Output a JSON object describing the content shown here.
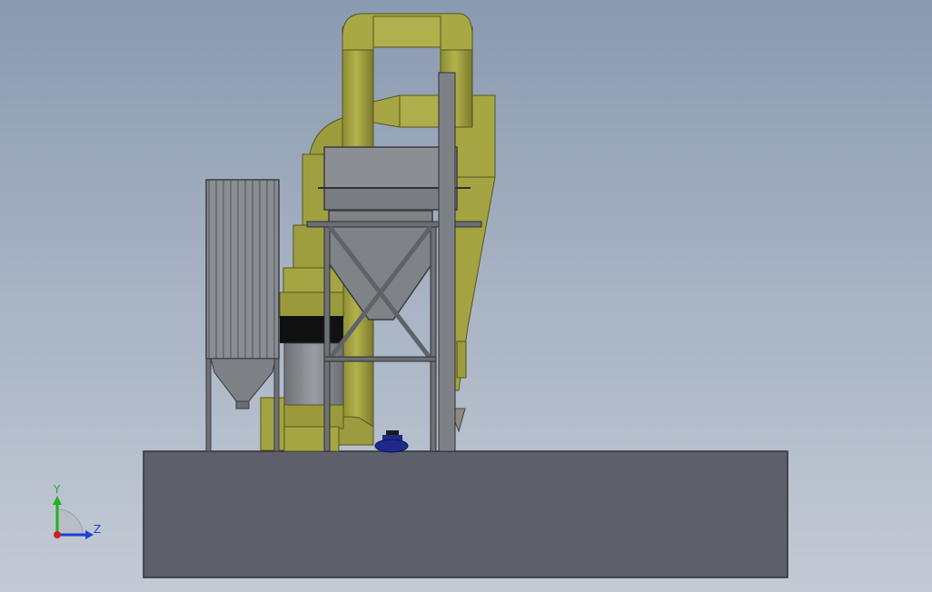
{
  "viewport": {
    "background_top": "#8a9ab0",
    "background_bottom": "#c3cad5"
  },
  "model": {
    "colors": {
      "duct_olive": "#a9a944",
      "duct_shadow": "#6e6e28",
      "steel_gray": "#7b7e83",
      "frame_gray": "#5f6268",
      "base_slab": "#5d606b",
      "motor_blue": "#1e2a8a",
      "band_black": "#111111"
    }
  },
  "triad": {
    "y_label": "Y",
    "z_label": "Z",
    "y_color": "#1db31d",
    "z_color": "#1f3fd6",
    "x_color": "#d11f1f"
  }
}
